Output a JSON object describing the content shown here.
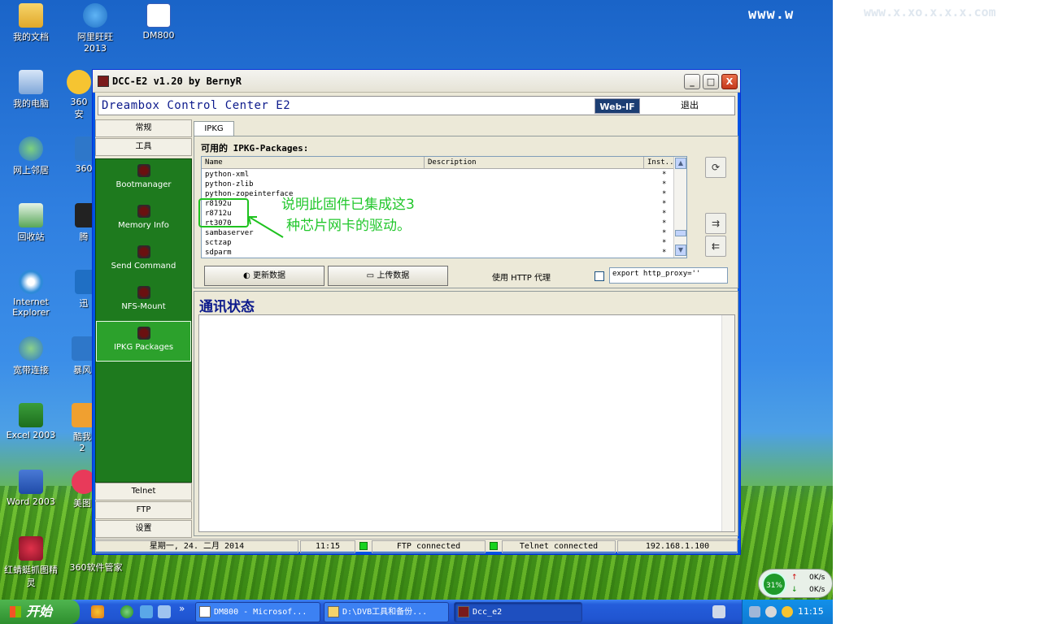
{
  "desktop": {
    "watermark": "www.w",
    "watermark_right": "www.x.xo.x.x.x.com",
    "icons": [
      {
        "label": "我的文档"
      },
      {
        "label": "阿里旺旺2013"
      },
      {
        "label": "DM800"
      },
      {
        "label": "我的电脑"
      },
      {
        "label": "360安"
      },
      {
        "label": "网上邻居"
      },
      {
        "label": "360"
      },
      {
        "label": "回收站"
      },
      {
        "label": "腾"
      },
      {
        "label": "Internet Explorer"
      },
      {
        "label": "迅"
      },
      {
        "label": "宽带连接"
      },
      {
        "label": "暴风"
      },
      {
        "label": "Excel 2003"
      },
      {
        "label": "酷我 2"
      },
      {
        "label": "Word 2003"
      },
      {
        "label": "美图"
      },
      {
        "label": "红蜻蜓抓图精灵"
      },
      {
        "label": "360软件管家"
      }
    ]
  },
  "window": {
    "title": "DCC-E2 v1.20 by BernyR",
    "header_title": "Dreambox Control Center E2",
    "webif_label": "Web-IF",
    "quit_label": "退出",
    "minimize": "_",
    "maximize": "□",
    "close": "X"
  },
  "sidebar": {
    "top_tabs": [
      "常规",
      "工具"
    ],
    "items": [
      {
        "label": "Bootmanager"
      },
      {
        "label": "Memory Info"
      },
      {
        "label": "Send Command"
      },
      {
        "label": "NFS-Mount"
      },
      {
        "label": "IPKG Packages"
      }
    ],
    "bottom_tabs": [
      "Telnet",
      "FTP",
      "设置"
    ]
  },
  "content": {
    "tab_label": "IPKG",
    "pkg_label": "可用的 IPKG-Packages:",
    "columns": [
      "Name",
      "Description",
      "Inst..."
    ],
    "rows": [
      {
        "name": "python-xml",
        "inst": "*"
      },
      {
        "name": "python-zlib",
        "inst": "*"
      },
      {
        "name": "python-zopeinterface",
        "inst": "*"
      },
      {
        "name": "r8192u",
        "inst": "*"
      },
      {
        "name": "r8712u",
        "inst": "*"
      },
      {
        "name": "rt3070",
        "inst": "*"
      },
      {
        "name": "sambaserver",
        "inst": "*"
      },
      {
        "name": "sctzap",
        "inst": "*"
      },
      {
        "name": "sdparm",
        "inst": "*"
      }
    ],
    "refresh_button": "更新数据",
    "upload_button": "上传数据",
    "proxy_label": "使用 HTTP 代理",
    "proxy_value": "export http_proxy=''",
    "annotation_line1": "说明此固件已集成这3",
    "annotation_line2": "种芯片网卡的驱动。",
    "status_title": "通讯状态"
  },
  "statusbar": {
    "date": "星期一, 24. 二月 2014",
    "time": "11:15",
    "ftp": "FTP connected",
    "telnet": "Telnet connected",
    "ip": "192.168.1.100"
  },
  "netwidget": {
    "percent": "31%",
    "up": "0K/s",
    "down": "0K/s"
  },
  "taskbar": {
    "start_label": "开始",
    "more": "»",
    "items": [
      {
        "label": "DM800 - Microsof..."
      },
      {
        "label": "D:\\DVB工具和备份..."
      },
      {
        "label": "Dcc_e2"
      }
    ],
    "clock": "11:15"
  },
  "colors": {
    "sidebar_green": "#1e7a1e",
    "annotation_green": "#22c72c",
    "header_blue": "#0c1a8c",
    "led_green": "#17d21e"
  }
}
